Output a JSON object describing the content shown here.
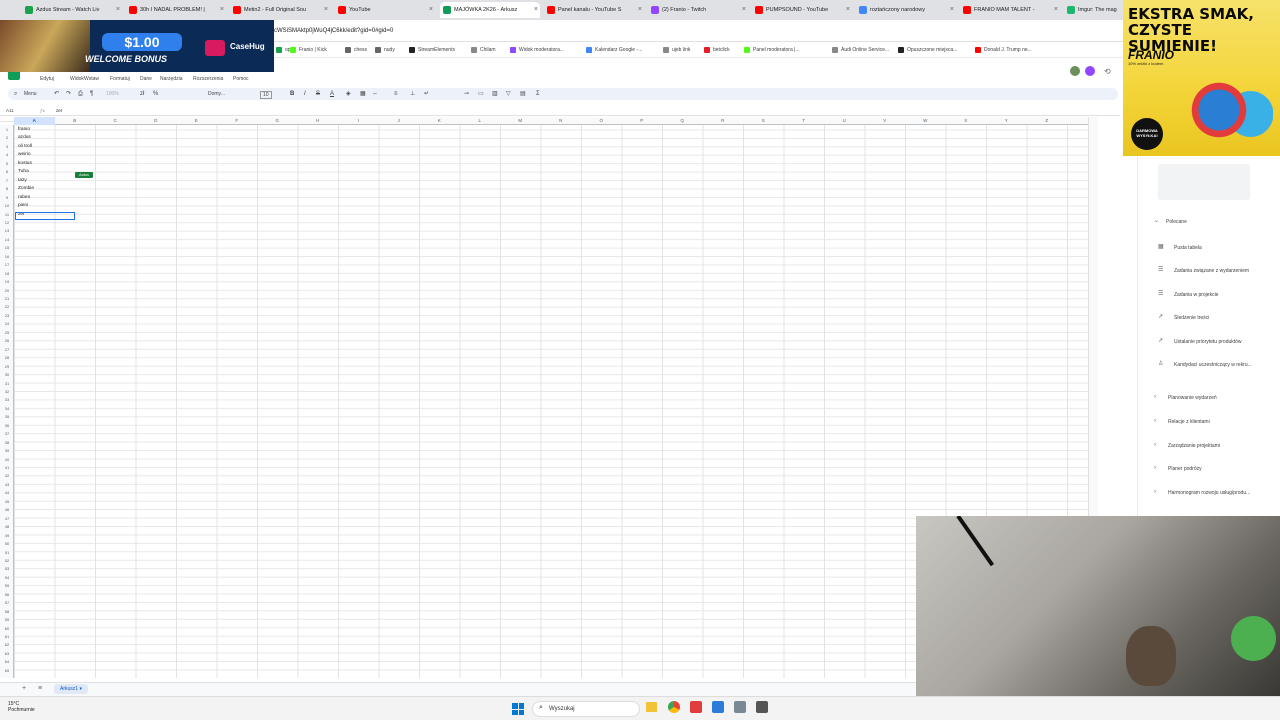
{
  "tabs": [
    {
      "label": "Azdus Stream - Watch Liv",
      "color": "#1aa34a"
    },
    {
      "label": "30h I NADAL PROBLEM! |",
      "color": "#ff0000"
    },
    {
      "label": "Metin2 - Full Original Sou",
      "color": "#ff0000"
    },
    {
      "label": "YouTube",
      "color": "#ff0000"
    },
    {
      "label": "MAJÓWKA 2K26 - Arkusz",
      "color": "#0f9d58"
    },
    {
      "label": "Panel kanału - YouTube S",
      "color": "#ff0000"
    },
    {
      "label": "(2) Franio - Twitch",
      "color": "#9146ff"
    },
    {
      "label": "PUMPSOUND - YouTube",
      "color": "#ff0000"
    },
    {
      "label": "roztańczony narodowy",
      "color": "#4285f4"
    },
    {
      "label": "FRANIO MAM TALENT -",
      "color": "#ff0000"
    },
    {
      "label": "Imgur: The mag",
      "color": "#1bb76e"
    }
  ],
  "url": "cWSiSMAktp0jWuQ4jC6kk/edit?gid=0#gid=0",
  "bookmarks": [
    {
      "label": "op",
      "color": "#1aa34a"
    },
    {
      "label": "Franio | Kick",
      "color": "#53fc18"
    },
    {
      "label": "chess",
      "color": "#666666"
    },
    {
      "label": "nudy",
      "color": "#666666"
    },
    {
      "label": "StreamElements",
      "color": "#222222"
    },
    {
      "label": "Chilam",
      "color": "#888888"
    },
    {
      "label": "Widok moderatora...",
      "color": "#9146ff"
    },
    {
      "label": "Kalendarz Google -...",
      "color": "#4285f4"
    },
    {
      "label": "ujeb link",
      "color": "#888888"
    },
    {
      "label": "betclick",
      "color": "#e31e24"
    },
    {
      "label": "Panel moderatora |...",
      "color": "#53fc18"
    },
    {
      "label": "Audi Online Service...",
      "color": "#888888"
    },
    {
      "label": "Opuszczone miejsca...",
      "color": "#222222"
    },
    {
      "label": "Donald J. Trump ne...",
      "color": "#ff0000"
    }
  ],
  "menus": [
    "Edytuj",
    "Widok",
    "Wstaw",
    "Formatuj",
    "Dane",
    "Narzędzia",
    "Rozszerzenia",
    "Pomoc"
  ],
  "toolbar": {
    "search": "Menu",
    "zoom": "100%",
    "font": "Domy...",
    "size": "10"
  },
  "namebox": "A11",
  "formula": "zer",
  "columns": [
    "A",
    "B",
    "C",
    "D",
    "E",
    "F",
    "G",
    "H",
    "I",
    "J",
    "K",
    "L",
    "M",
    "N",
    "O",
    "P",
    "Q",
    "R",
    "S",
    "T",
    "U",
    "V",
    "W",
    "X",
    "Y",
    "Z"
  ],
  "cells": [
    "franio",
    "azdus",
    "oli troll",
    "weirio",
    "kostus",
    "Tuha",
    "tazy",
    "Zombie",
    "ruben",
    "pieni",
    "zer"
  ],
  "chip": "Azdus",
  "sidepanel": {
    "section": "Polecane",
    "items": [
      "Pusta tabela",
      "Zadania związane z wydarzeniem",
      "Zadania w projekcie",
      "Śledzenie treści",
      "Ustalanie priorytetu produktów",
      "Kandydaci uczestniczący w rekru..."
    ],
    "groups": [
      "Planowanie wydarzeń",
      "Relacje z klientami",
      "Zarządzanie projektami",
      "Planer podróży",
      "Harmonogram rozwoju usług/produ..."
    ]
  },
  "sheet_tab": "Arkusz1",
  "taskbar": {
    "search": "Wyszukaj",
    "temp": "15°C",
    "weather": "Pochmurnie"
  },
  "ad_left": {
    "amount": "$1.00",
    "headline": "WELCOME BONUS",
    "brand": "CaseHug"
  },
  "ad_right": {
    "line1": "EKSTRA SMAK,",
    "line2": "CZYSTE SUMIENIE!",
    "brand": "FRANIO",
    "promo": "10% zniżki z kodem",
    "badge": "DARMOWA WYSYŁKA!"
  }
}
